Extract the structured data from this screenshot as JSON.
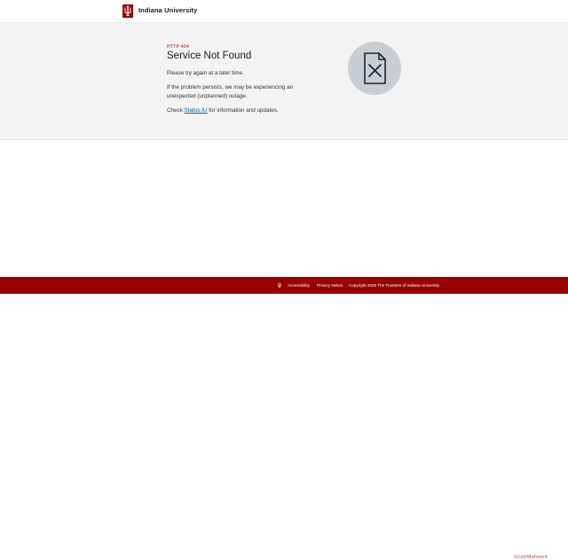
{
  "header": {
    "brand": "Indiana University"
  },
  "main": {
    "code": "HTTP 404",
    "title": "Service Not Found",
    "p1": "Please try again at a later time.",
    "p2": "If the problem persists, we may be experiencing an unexpected (unplanned) outage.",
    "p3_before": "Check ",
    "p3_link": "Status.IU",
    "p3_after": " for information and updates.",
    "illustration_icon": "document-x-icon"
  },
  "footer": {
    "accessibility": "Accessibility",
    "privacy": "Privacy Notice",
    "copyright": "Copyright 2025 The Trustees of Indiana University"
  },
  "watermark": "ScanMalware",
  "colors": {
    "brand_crimson": "#990000",
    "link_blue": "#006298",
    "hero_bg": "#f3f3f3",
    "icon_circle": "#c9ced3"
  }
}
